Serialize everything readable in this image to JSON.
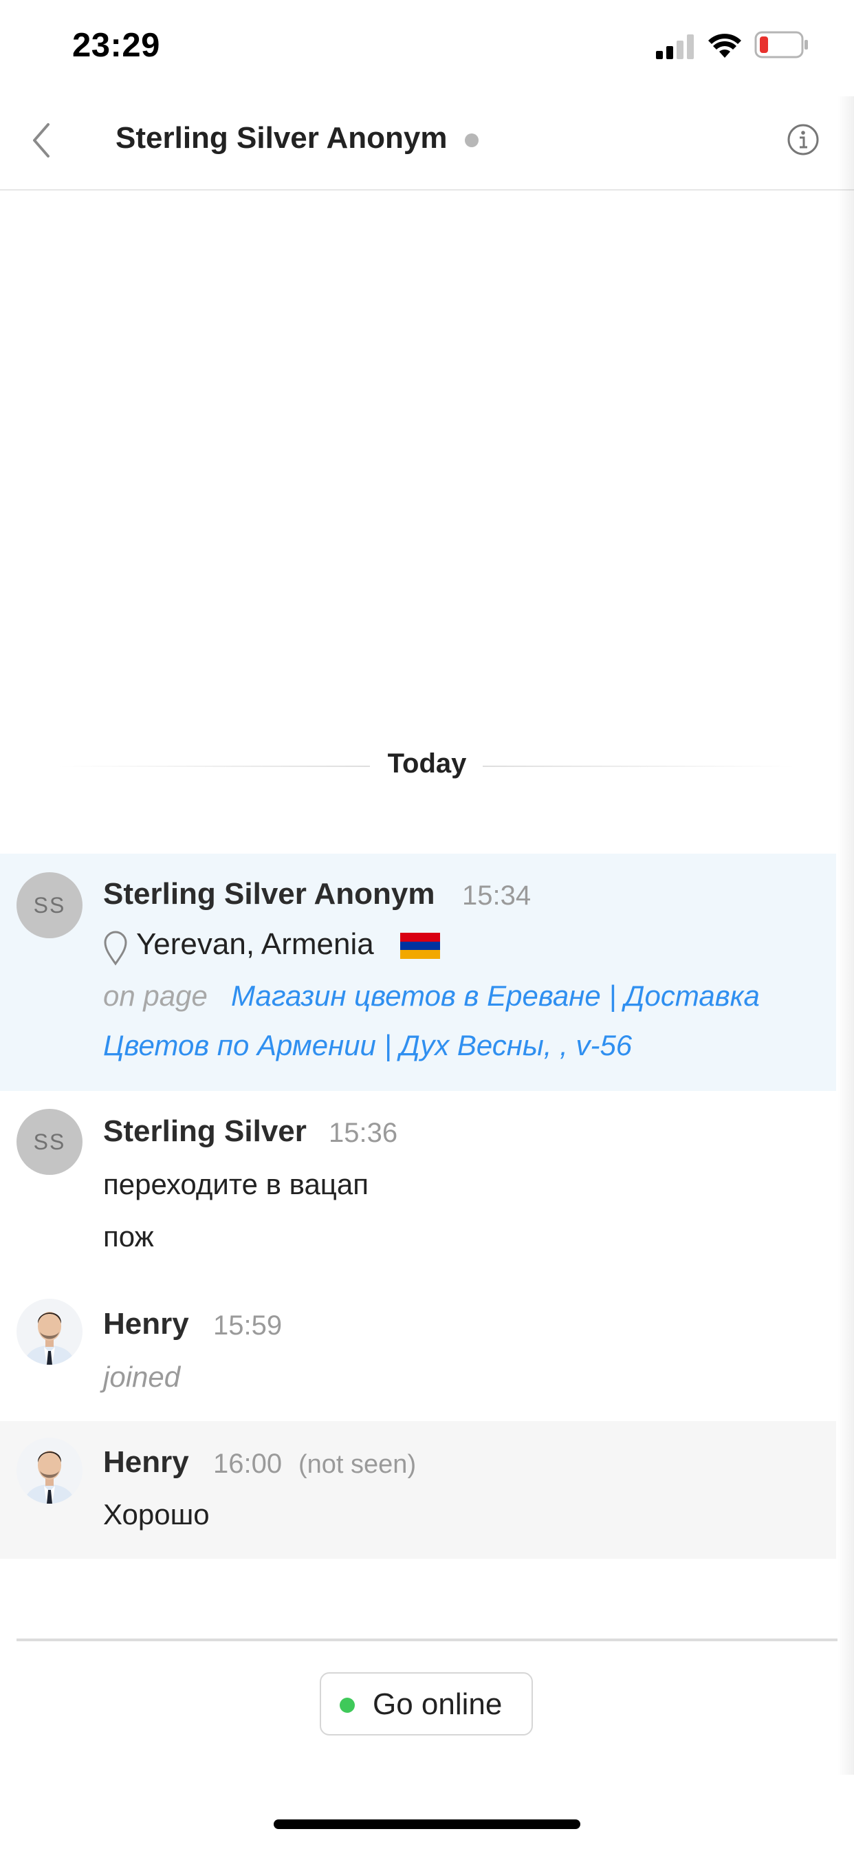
{
  "status_bar": {
    "time": "23:29",
    "icons": [
      "signal-icon",
      "wifi-icon",
      "battery-low-icon"
    ],
    "battery_color": "#e8322e"
  },
  "header": {
    "title": "Sterling Silver Anonym",
    "presence_color": "#b7b7b7",
    "icons": [
      "chevron-left-icon",
      "info-icon"
    ]
  },
  "separator": {
    "label": "Today"
  },
  "messages": [
    {
      "avatar": "SS",
      "author": "Sterling Silver Anonym",
      "time": "15:34",
      "location": "Yerevan, Armenia",
      "flag": "armenia-flag-icon",
      "page_prefix": "on page",
      "page_link_line1": "Магазин цветов в Ереване | Доставка",
      "page_link_line2": "Цветов по Армении | Дух Весны, , v-56",
      "background": "#f0f7fc"
    },
    {
      "avatar": "SS",
      "author": "Sterling Silver",
      "time": "15:36",
      "lines": [
        "переходите в вацап",
        "пож"
      ]
    },
    {
      "avatar": "henry-avatar",
      "author": "Henry",
      "time": "15:59",
      "event": "joined"
    },
    {
      "avatar": "henry-avatar",
      "author": "Henry",
      "time": "16:00",
      "status": "(not seen)",
      "text": "Хорошо",
      "background": "#f6f6f6"
    }
  ],
  "footer": {
    "go_online_label": "Go online",
    "online_color": "#3fc95a"
  }
}
